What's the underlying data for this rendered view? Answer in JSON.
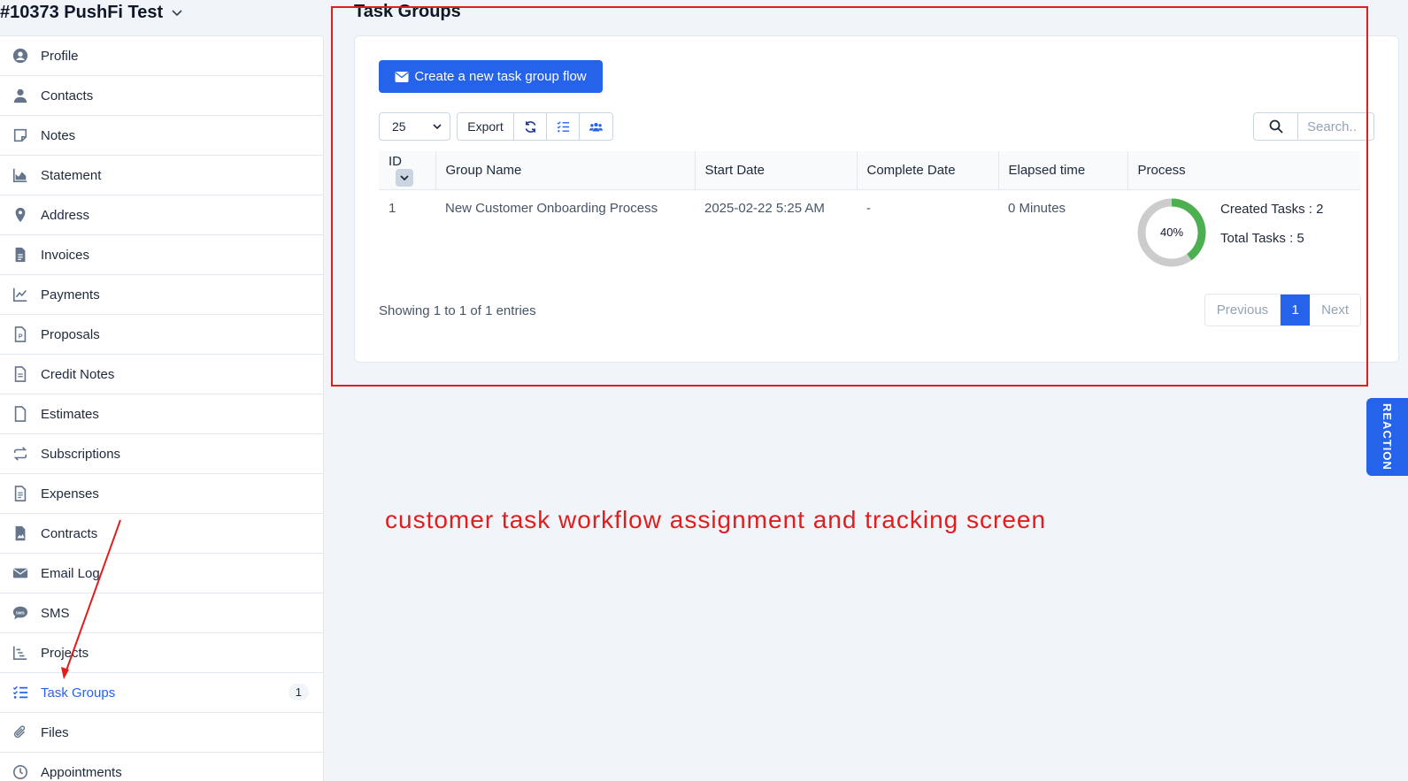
{
  "client": {
    "title": "#10373 PushFi Test"
  },
  "sidebar": {
    "items": [
      {
        "label": "Profile",
        "icon": "user-circle-icon"
      },
      {
        "label": "Contacts",
        "icon": "user-icon"
      },
      {
        "label": "Notes",
        "icon": "sticky-note-icon"
      },
      {
        "label": "Statement",
        "icon": "area-chart-icon"
      },
      {
        "label": "Address",
        "icon": "map-pin-icon"
      },
      {
        "label": "Invoices",
        "icon": "file-text-icon"
      },
      {
        "label": "Payments",
        "icon": "line-chart-icon"
      },
      {
        "label": "Proposals",
        "icon": "file-p-icon"
      },
      {
        "label": "Credit Notes",
        "icon": "file-lines-icon"
      },
      {
        "label": "Estimates",
        "icon": "file-icon"
      },
      {
        "label": "Subscriptions",
        "icon": "repeat-icon"
      },
      {
        "label": "Expenses",
        "icon": "file-alt-icon"
      },
      {
        "label": "Contracts",
        "icon": "file-image-icon"
      },
      {
        "label": "Email Log",
        "icon": "envelope-icon"
      },
      {
        "label": "SMS",
        "icon": "sms-icon"
      },
      {
        "label": "Projects",
        "icon": "bars-staggered-icon"
      },
      {
        "label": "Task Groups",
        "icon": "list-check-icon",
        "badge": "1",
        "active": true
      },
      {
        "label": "Files",
        "icon": "paperclip-icon"
      },
      {
        "label": "Appointments",
        "icon": "clock-icon"
      }
    ]
  },
  "main": {
    "title": "Task Groups",
    "create_button": "Create a new task group flow",
    "page_length": "25",
    "export_label": "Export",
    "search_placeholder": "Search..",
    "table": {
      "headers": [
        "ID",
        "Group Name",
        "Start Date",
        "Complete Date",
        "Elapsed time",
        "Process"
      ],
      "rows": [
        {
          "id": "1",
          "group_name": "New Customer Onboarding Process",
          "start_date": "2025-02-22 5:25 AM",
          "complete_date": "-",
          "elapsed": "0 Minutes",
          "progress_label": "40%",
          "progress_value": 0.4,
          "created_tasks": "Created Tasks : 2",
          "total_tasks": "Total Tasks : 5"
        }
      ]
    },
    "showing": "Showing 1 to 1 of 1 entries",
    "pagination": {
      "previous": "Previous",
      "current": "1",
      "next": "Next"
    }
  },
  "annotation": {
    "caption": "customer task workflow assignment and tracking screen"
  },
  "reaction_tab": {
    "label": "REACTION"
  },
  "colors": {
    "accent": "#2563eb",
    "annotation": "#e11d1d",
    "progress": "#4caf50",
    "progress_track": "#cccccc"
  }
}
